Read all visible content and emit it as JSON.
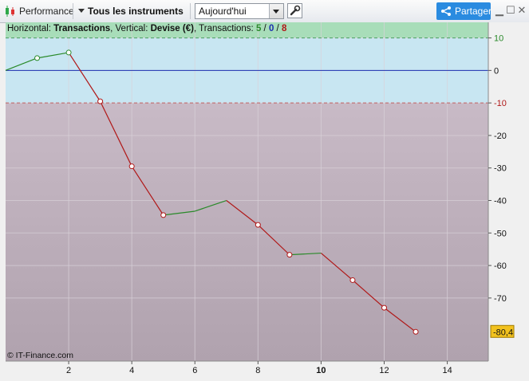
{
  "toolbar": {
    "app_label": "Performance",
    "instrument_label": "Tous les instruments",
    "period_select_value": "Aujourd'hui",
    "share_label": "Partager"
  },
  "colors": {
    "win_zone": "#a8ddb9",
    "neutral_zone": "#c8e6f2",
    "loss_zone": "#c2b3bf",
    "win_line": "#2a8a2a",
    "loss_line": "#b01818",
    "zero_line": "#1a2eb0",
    "last_badge": "#f2c21f"
  },
  "chart_data": {
    "type": "line",
    "header": {
      "prefix_horizontal": "Horizontal: ",
      "horizontal_value": "Transactions",
      "prefix_vertical": ", Vertical: ",
      "vertical_value": "Devise (€)",
      "prefix_transactions": ", Transactions: ",
      "wins": "5",
      "slash1": " / ",
      "neutral": "0",
      "slash2": " / ",
      "losses": "8"
    },
    "x": [
      0,
      1,
      2,
      3,
      4,
      5,
      6,
      7,
      8,
      9,
      10,
      11,
      12,
      13
    ],
    "y": [
      0,
      3.8,
      5.5,
      -9.5,
      -29.5,
      -44.5,
      -43.3,
      -40,
      -47.5,
      -56.7,
      -56.2,
      -64.5,
      -73,
      -80.4
    ],
    "marked_points": [
      1,
      2,
      3,
      4,
      5,
      8,
      9,
      11,
      12,
      13
    ],
    "xlim": [
      0,
      15.3
    ],
    "ylim": [
      -89.4,
      14.8
    ],
    "x_ticks": [
      "2",
      "4",
      "6",
      "8",
      "10",
      "12",
      "14"
    ],
    "x_tick_values": [
      2,
      4,
      6,
      8,
      10,
      12,
      14
    ],
    "y_ticks": [
      "10",
      "0",
      "-10",
      "-20",
      "-30",
      "-40",
      "-50",
      "-60",
      "-70"
    ],
    "y_tick_values": [
      10,
      0,
      -10,
      -20,
      -30,
      -40,
      -50,
      -60,
      -70
    ],
    "win_threshold": 10,
    "loss_threshold": -10,
    "last_value_label": "-80,4",
    "last_value": -80.4,
    "grid": true,
    "watermark": "© IT-Finance.com"
  }
}
